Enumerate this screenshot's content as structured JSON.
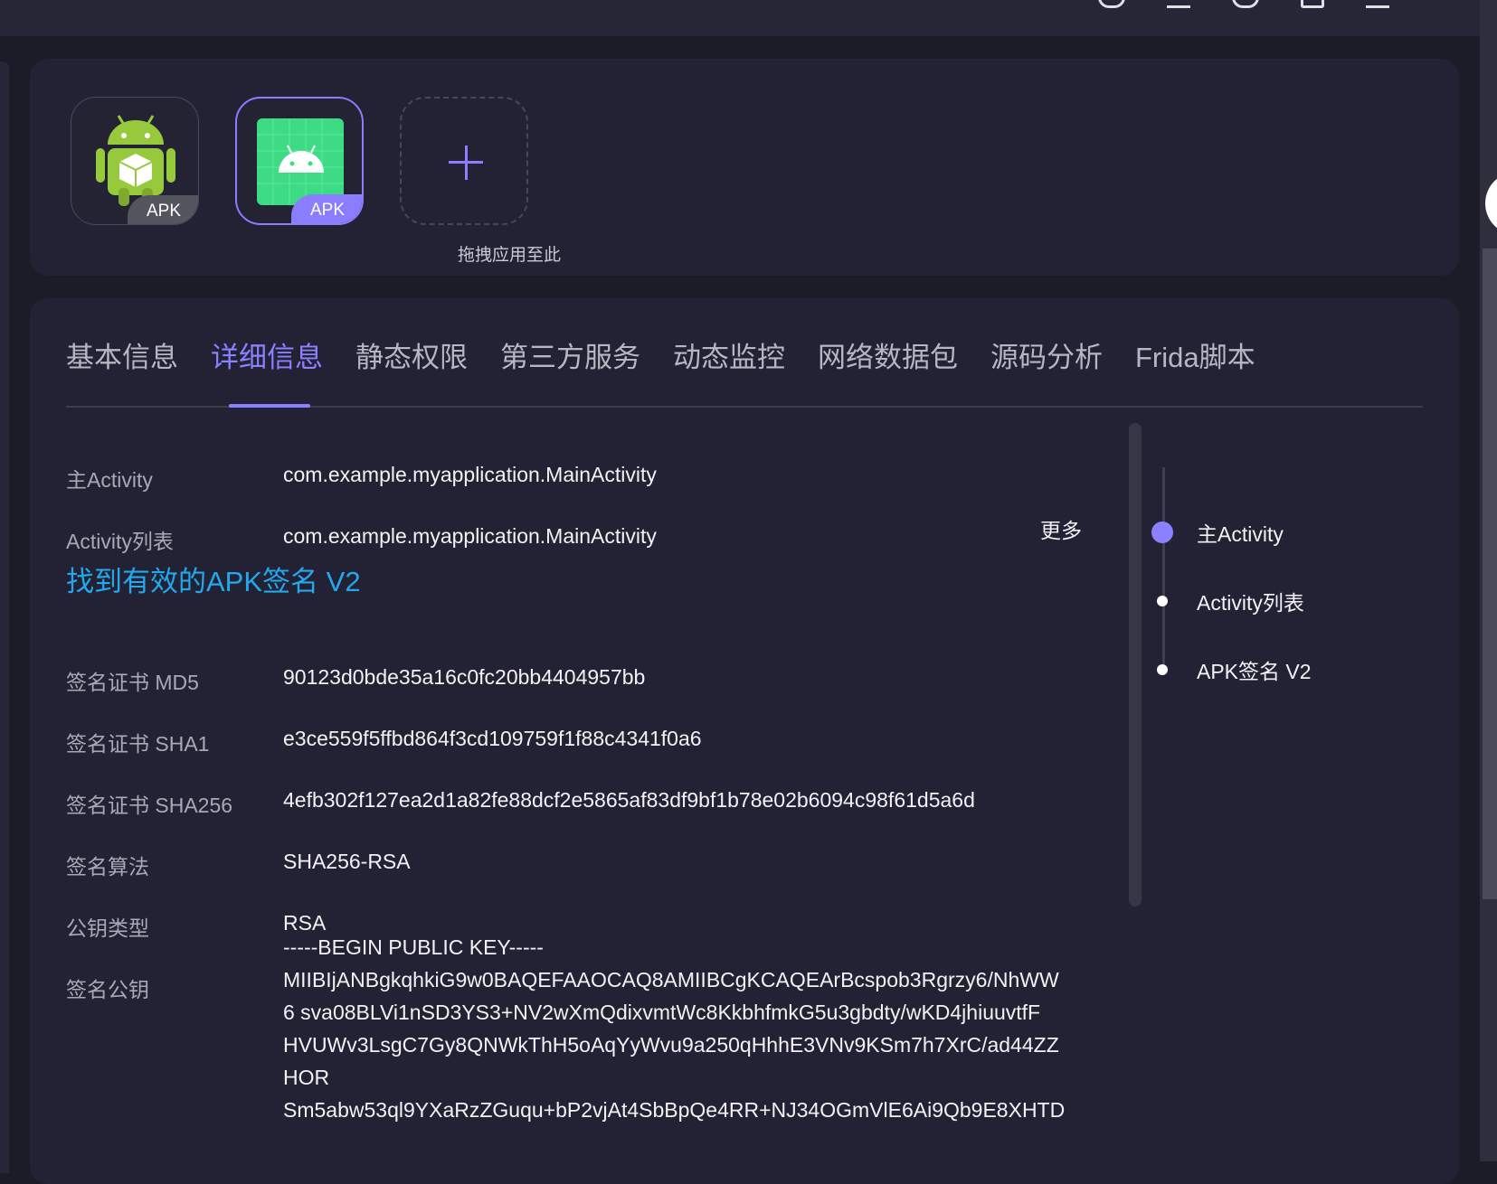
{
  "apps": {
    "badge": "APK",
    "drop_label": "拖拽应用至此"
  },
  "tabs": [
    "基本信息",
    "详细信息",
    "静态权限",
    "第三方服务",
    "动态监控",
    "网络数据包",
    "源码分析",
    "Frida脚本"
  ],
  "active_tab": "详细信息",
  "rows": {
    "main_activity": {
      "label": "主Activity",
      "value": "com.example.myapplication.MainActivity"
    },
    "activity_list": {
      "label": "Activity列表",
      "value": "com.example.myapplication.MainActivity",
      "more": "更多"
    },
    "section_title": "找到有效的APK签名 V2",
    "md5": {
      "label": "签名证书 MD5",
      "value": "90123d0bde35a16c0fc20bb4404957bb"
    },
    "sha1": {
      "label": "签名证书 SHA1",
      "value": "e3ce559f5ffbd864f3cd109759f1f88c4341f0a6"
    },
    "sha256": {
      "label": "签名证书 SHA256",
      "value": "4efb302f127ea2d1a82fe88dcf2e5865af83df9bf1b78e02b6094c98f61d5a6d"
    },
    "algo": {
      "label": "签名算法",
      "value": "SHA256-RSA"
    },
    "key_type": {
      "label": "公钥类型",
      "value": "RSA"
    },
    "pubkey": {
      "label": "签名公钥",
      "lines": [
        "-----BEGIN PUBLIC KEY-----",
        "MIIBIjANBgkqhkiG9w0BAQEFAAOCAQ8AMIIBCgKCAQEArBcspob3Rgrzy6/NhWW",
        "6 sva08BLVi1nSD3YS3+NV2wXmQdixvmtWc8KkbhfmkG5u3gbdty/wKD4jhiuuvtfF",
        "HVUWv3LsgC7Gy8QNWkThH5oAqYyWvu9a250qHhhE3VNv9KSm7h7XrC/ad44ZZ",
        "HOR",
        "Sm5abw53ql9YXaRzZGuqu+bP2vjAt4SbBpQe4RR+NJ34OGmVlE6Ai9Qb9E8XHTD"
      ]
    }
  },
  "anchors": [
    {
      "label": "主Activity",
      "active": true
    },
    {
      "label": "Activity列表",
      "active": false
    },
    {
      "label": "APK签名 V2",
      "active": false
    }
  ],
  "colors": {
    "accent": "#8b80ff",
    "section": "#23a8ee",
    "bg": "#1c1c29",
    "card": "#222234"
  }
}
